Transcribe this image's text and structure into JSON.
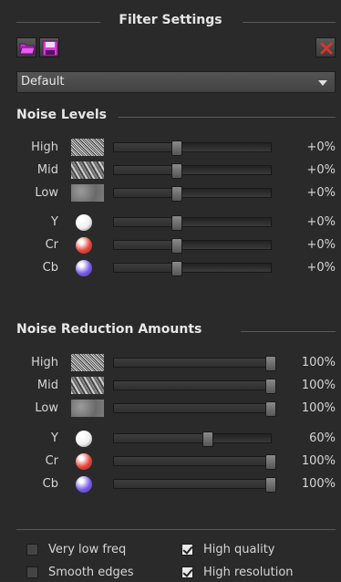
{
  "title": "Filter Settings",
  "toolbar": {
    "open_icon": "folder-open-icon",
    "save_icon": "floppy-save-icon",
    "delete_icon": "close-x-icon"
  },
  "preset": {
    "value": "Default"
  },
  "noise_levels": {
    "title": "Noise Levels",
    "rows": [
      {
        "label": "High",
        "value_text": "+0%",
        "level": 0.4,
        "swatch": "high-noise"
      },
      {
        "label": "Mid",
        "value_text": "+0%",
        "level": 0.4,
        "swatch": "mid-noise"
      },
      {
        "label": "Low",
        "value_text": "+0%",
        "level": 0.4,
        "swatch": "low-noise"
      },
      {
        "label": "Y",
        "value_text": "+0%",
        "level": 0.4,
        "color": "#f0f0f0"
      },
      {
        "label": "Cr",
        "value_text": "+0%",
        "level": 0.4,
        "color": "#e8473c"
      },
      {
        "label": "Cb",
        "value_text": "+0%",
        "level": 0.4,
        "color": "#7a5cf0"
      }
    ]
  },
  "noise_reduction": {
    "title": "Noise Reduction Amounts",
    "rows": [
      {
        "label": "High",
        "value_text": "100%",
        "level": 1.0,
        "swatch": "high-noise"
      },
      {
        "label": "Mid",
        "value_text": "100%",
        "level": 1.0,
        "swatch": "mid-noise"
      },
      {
        "label": "Low",
        "value_text": "100%",
        "level": 1.0,
        "swatch": "low-noise"
      },
      {
        "label": "Y",
        "value_text": "60%",
        "level": 0.6,
        "color": "#f0f0f0"
      },
      {
        "label": "Cr",
        "value_text": "100%",
        "level": 1.0,
        "color": "#e8473c"
      },
      {
        "label": "Cb",
        "value_text": "100%",
        "level": 1.0,
        "color": "#7a5cf0"
      }
    ]
  },
  "options": [
    {
      "label": "Very low freq",
      "checked": false
    },
    {
      "label": "High quality",
      "checked": true
    },
    {
      "label": "Smooth edges",
      "checked": false
    },
    {
      "label": "High resolution",
      "checked": true
    }
  ]
}
